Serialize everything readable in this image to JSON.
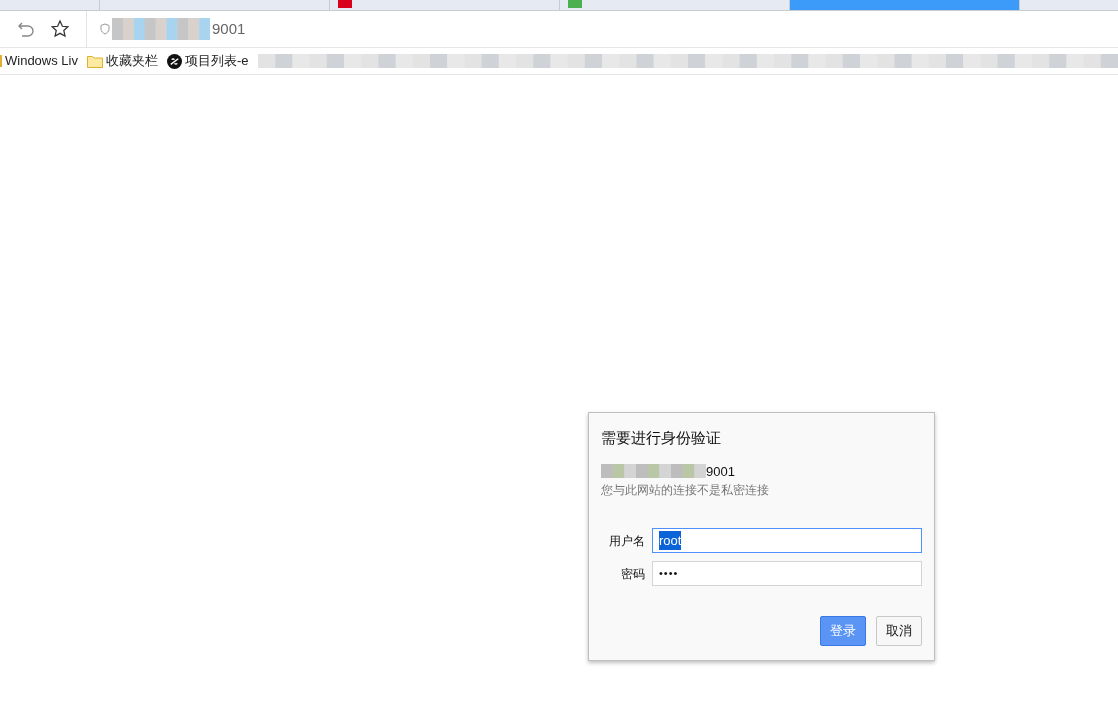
{
  "tabs": [
    {
      "selected": false
    },
    {
      "selected": false
    },
    {
      "selected": false,
      "color": "#d9001b"
    },
    {
      "selected": false,
      "color": "#4caf50"
    },
    {
      "selected": true
    }
  ],
  "toolbar": {
    "address_suffix": "9001"
  },
  "bookmarks": [
    {
      "kind": "plain",
      "label": "Windows Liv"
    },
    {
      "kind": "folder",
      "label": "收藏夹栏"
    },
    {
      "kind": "site",
      "label": "项目列表-e"
    }
  ],
  "dialog": {
    "title": "需要进行身份验证",
    "host_suffix": "9001",
    "warning": "您与此网站的连接不是私密连接",
    "fields": [
      {
        "label": "用户名",
        "value": "root",
        "kind": "text",
        "focused": true
      },
      {
        "label": "密码",
        "value": "••••",
        "kind": "password",
        "focused": false
      }
    ],
    "buttons": [
      {
        "label": "登录",
        "kind": "primary"
      },
      {
        "label": "取消",
        "kind": "secondary"
      }
    ]
  }
}
